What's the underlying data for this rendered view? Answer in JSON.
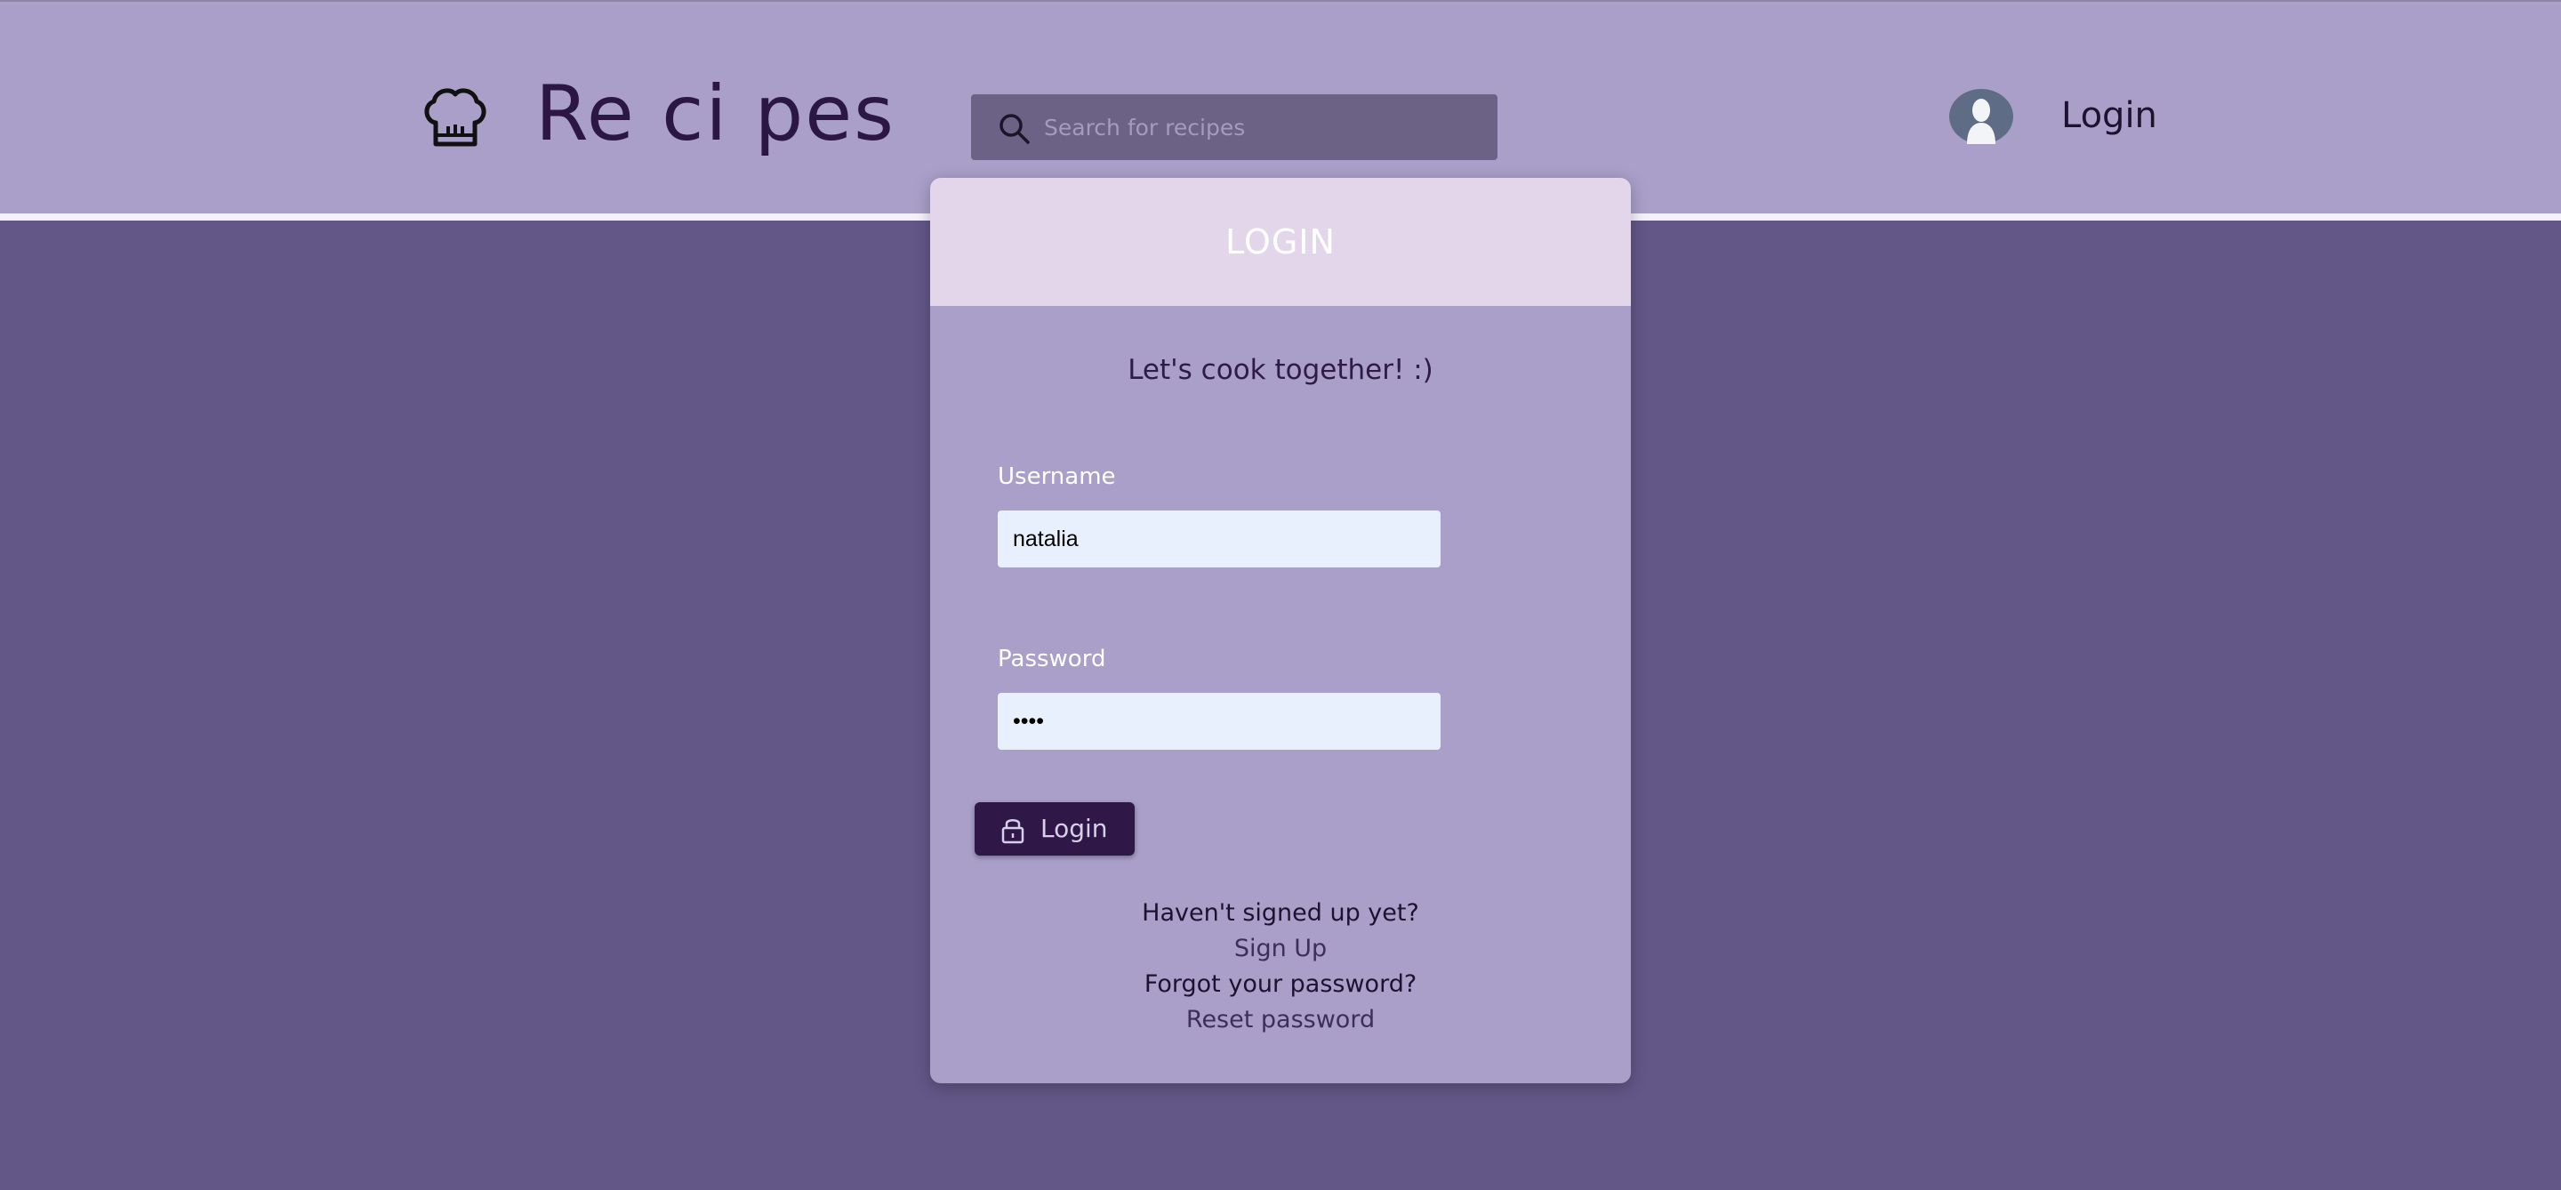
{
  "header": {
    "brand": "Re ci pes",
    "search": {
      "placeholder": "Search for recipes",
      "value": ""
    },
    "login_link": "Login"
  },
  "icons": {
    "logo": "chef-hat-icon",
    "search": "search-icon",
    "avatar": "user-avatar-icon",
    "lock": "lock-icon"
  },
  "login_card": {
    "title": "LOGIN",
    "tagline": "Let's cook together! :)",
    "username": {
      "label": "Username",
      "value": "natalia"
    },
    "password": {
      "label": "Password",
      "value": "••••"
    },
    "submit_label": "Login",
    "signup_prompt": "Haven't signed up yet?",
    "signup_link": "Sign Up",
    "forgot_prompt": "Forgot your password?",
    "reset_link": "Reset password"
  },
  "colors": {
    "header_bg": "#a99fc9",
    "page_bg": "#625787",
    "card_header_bg": "#e3d6ea",
    "button_bg": "#2f1747",
    "input_bg": "#e8f0fd"
  }
}
